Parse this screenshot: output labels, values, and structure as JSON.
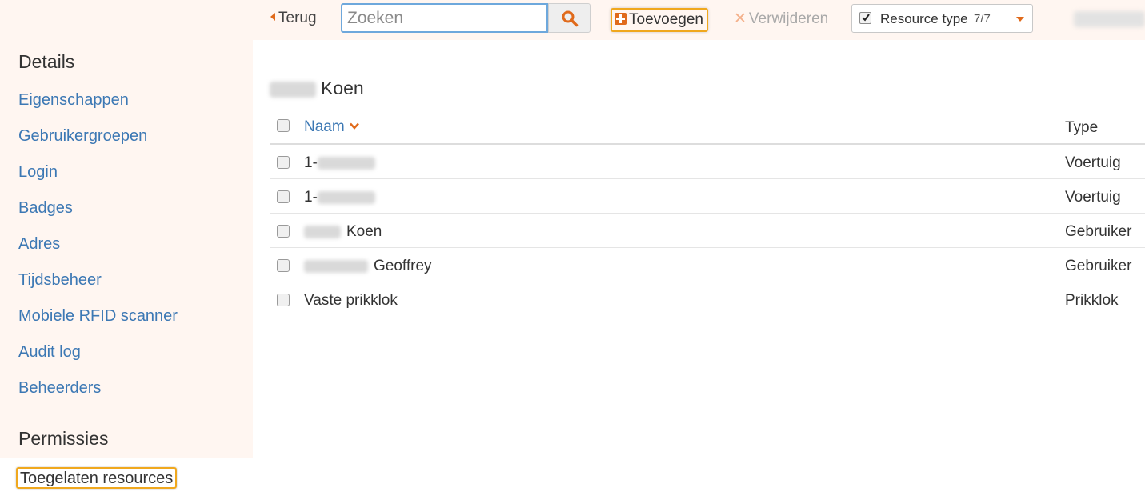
{
  "toolbar": {
    "back_label": "Terug",
    "search_placeholder": "Zoeken",
    "search_value": "",
    "add_label": "Toevoegen",
    "delete_label": "Verwijderen",
    "resource_type_label": "Resource type",
    "resource_type_count": "7/7"
  },
  "sidebar": {
    "details_heading": "Details",
    "items": [
      {
        "label": "Eigenschappen"
      },
      {
        "label": "Gebruikergroepen"
      },
      {
        "label": "Login"
      },
      {
        "label": "Badges"
      },
      {
        "label": "Adres"
      },
      {
        "label": "Tijdsbeheer"
      },
      {
        "label": "Mobiele RFID scanner"
      },
      {
        "label": "Audit log"
      },
      {
        "label": "Beheerders"
      }
    ],
    "permissions_heading": "Permissies",
    "active_item": "Toegelaten resources"
  },
  "main": {
    "title": "Koen",
    "columns": {
      "name": "Naam",
      "type": "Type"
    },
    "rows": [
      {
        "name": "1-",
        "type": "Voertuig"
      },
      {
        "name": "1-",
        "type": "Voertuig"
      },
      {
        "name": "Koen",
        "type": "Gebruiker"
      },
      {
        "name": "Geoffrey",
        "type": "Gebruiker"
      },
      {
        "name": "Vaste prikklok",
        "type": "Prikklok"
      }
    ]
  },
  "colors": {
    "accent": "#e06a1b",
    "link": "#3c78b4",
    "highlight_border": "#f0a81e",
    "sidebar_bg": "#fff6f1"
  },
  "icons": {
    "back": "caret-left-icon",
    "search": "search-icon",
    "add": "plus-square-icon",
    "delete": "x-icon",
    "filter_check": "checkbox-checked-icon",
    "dropdown": "caret-down-icon",
    "sort": "chevron-down-icon"
  }
}
